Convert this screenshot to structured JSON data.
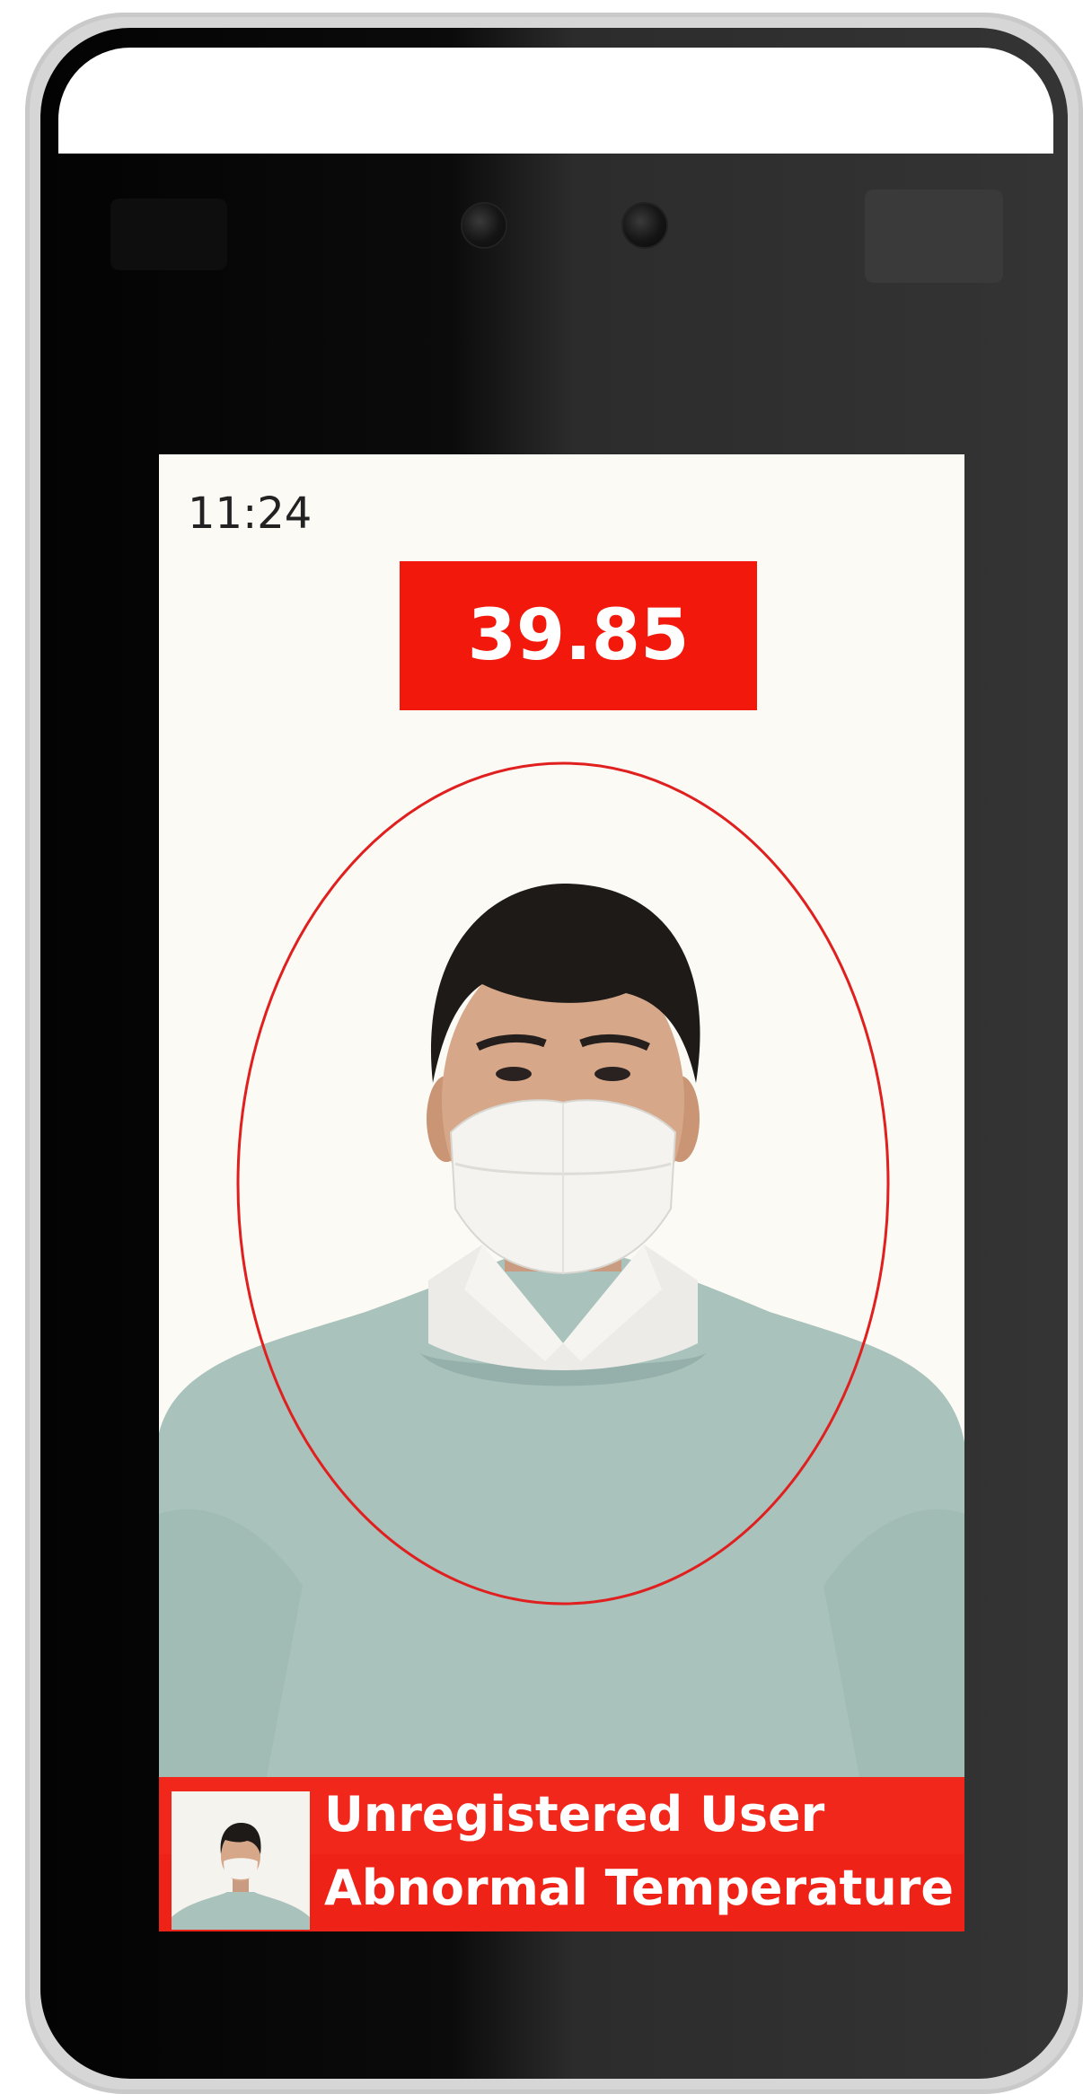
{
  "screen": {
    "clock": "11:24",
    "temperature": "39.85",
    "status": {
      "line1": "Unregistered User",
      "line2": "Abnormal Temperature"
    },
    "face_frame": "ellipse",
    "subject": "person wearing face mask"
  },
  "colors": {
    "alert_red": "#f2190c",
    "screen_bg": "#fbfaf5",
    "frame_outline": "#e01f1f",
    "bezel_dark": "#0b0b0b",
    "bezel_light": "#343434"
  },
  "icons": {
    "camera_left": "camera-lens-icon",
    "camera_right": "camera-lens-icon",
    "sensor": "ir-sensor-icon"
  }
}
